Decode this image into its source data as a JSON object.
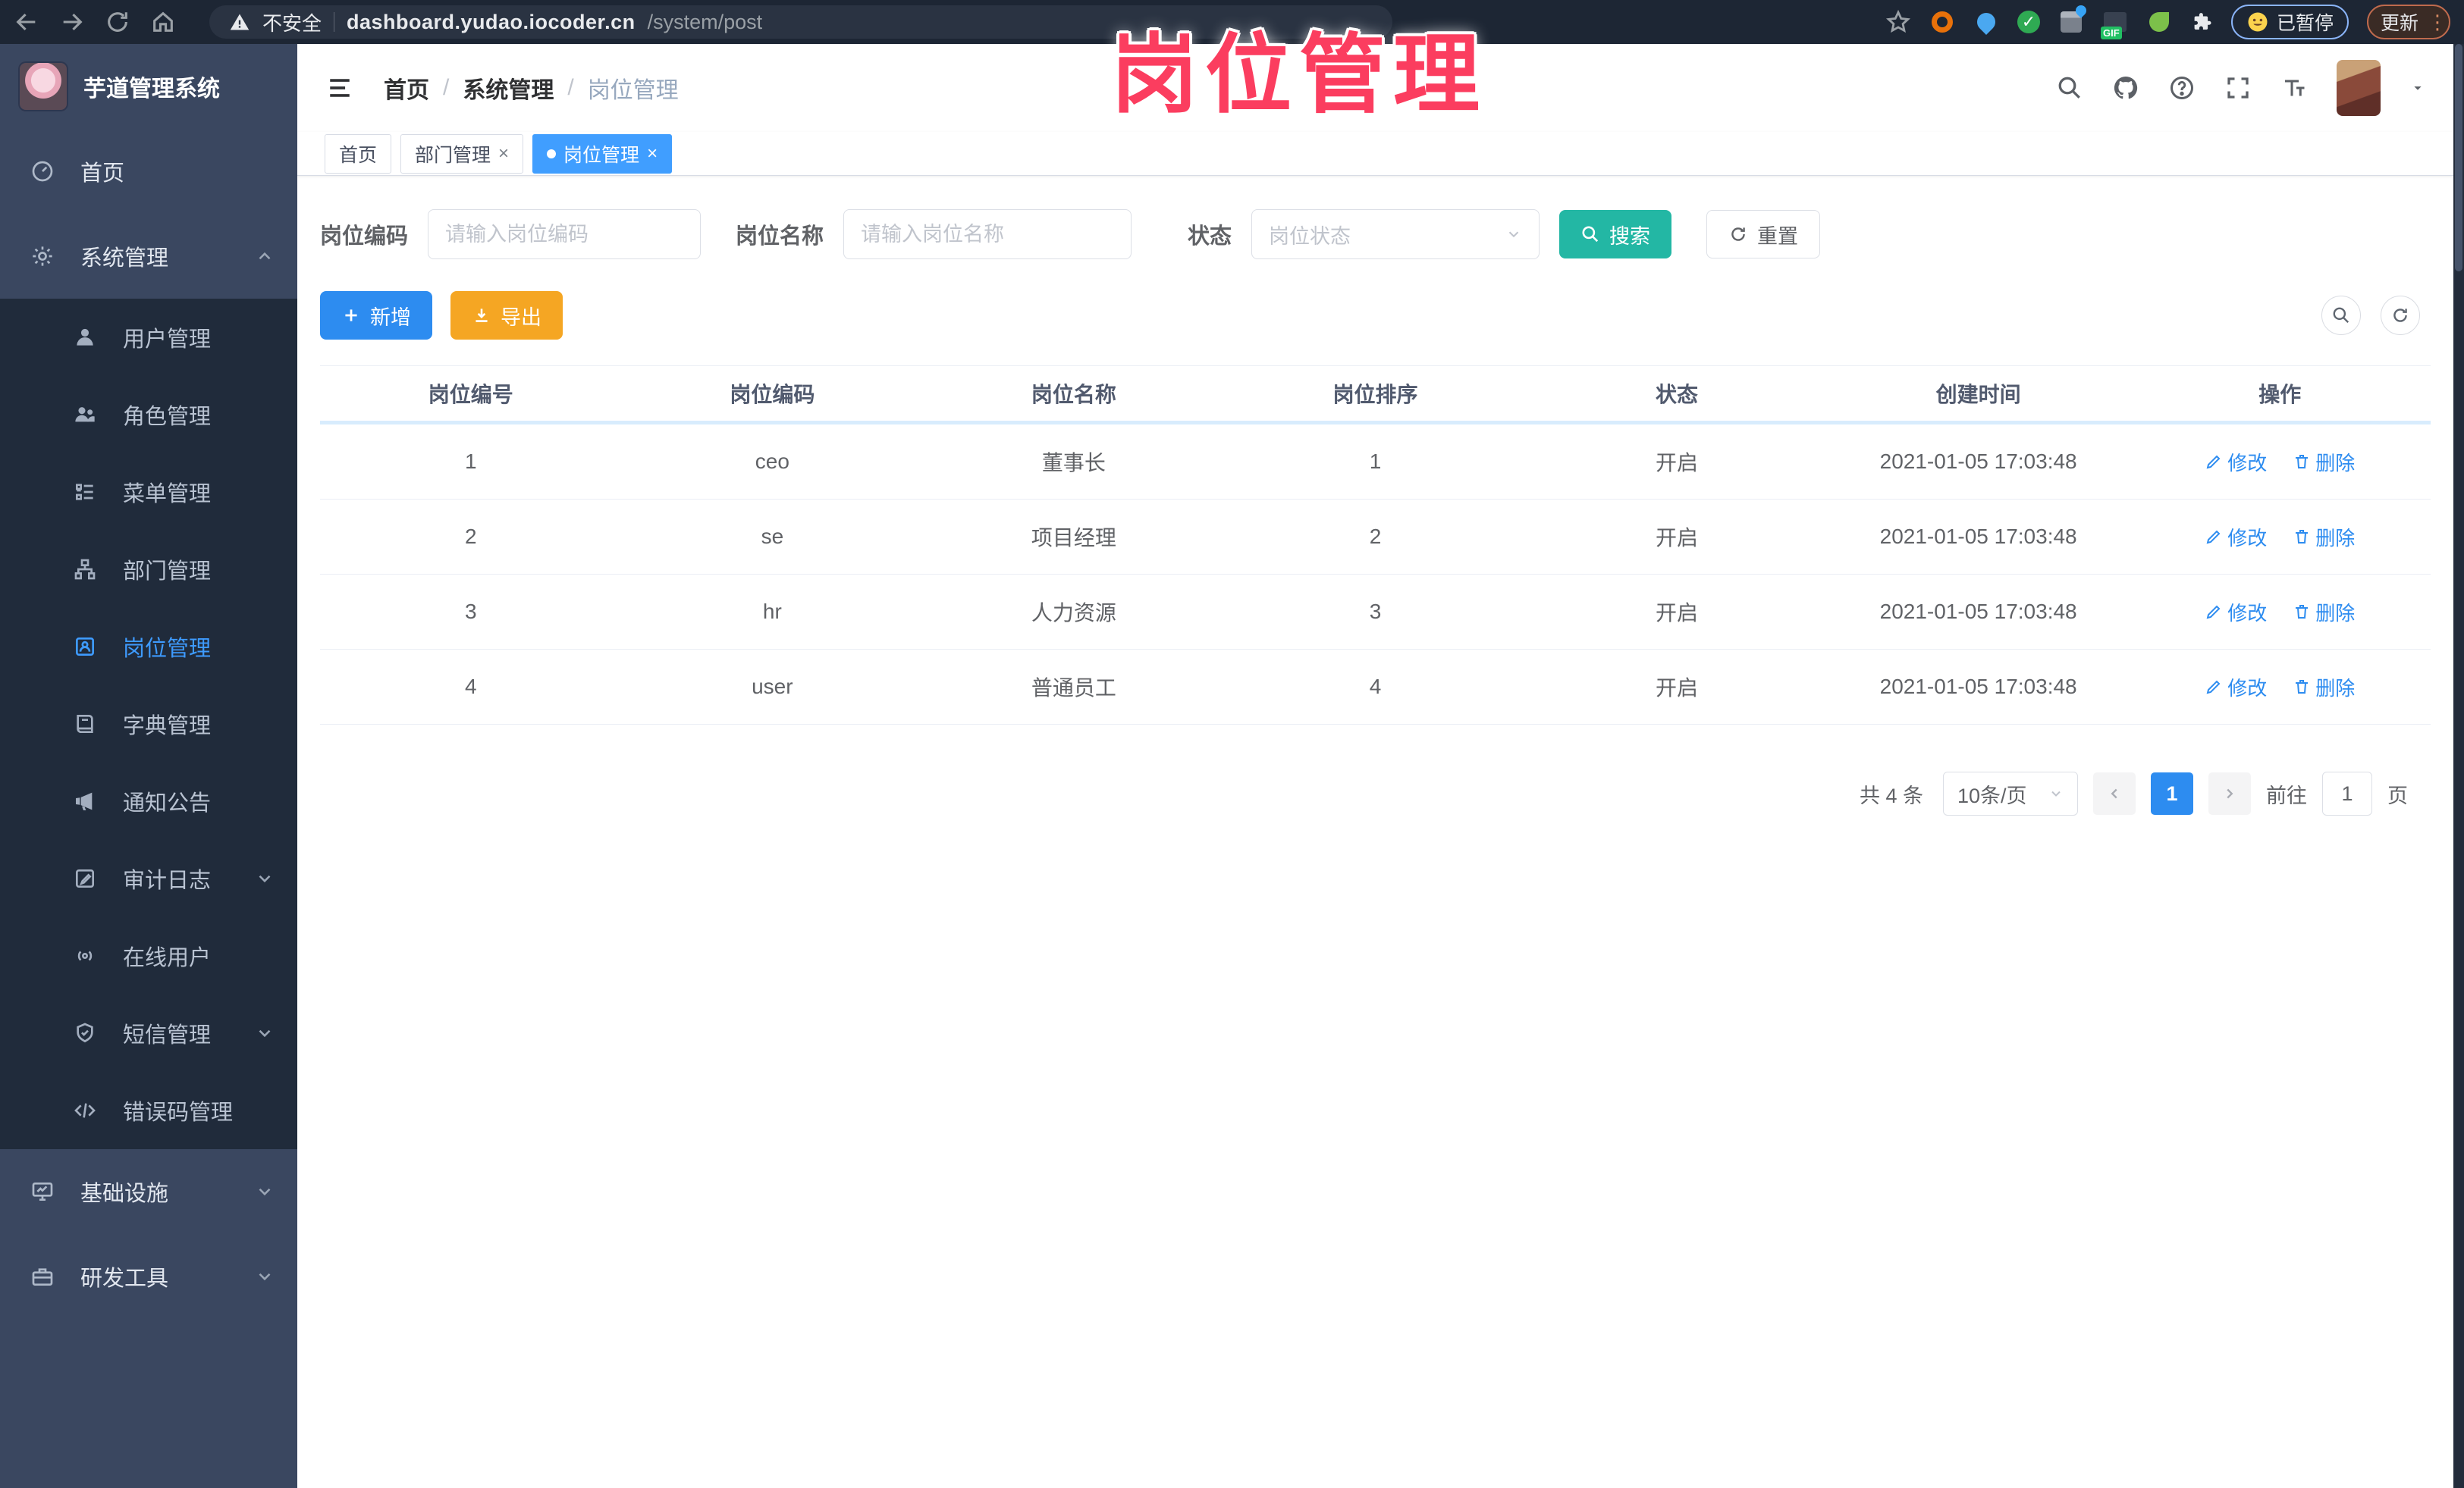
{
  "browser": {
    "security_label": "不安全",
    "url_host": "dashboard.yudao.iocoder.cn",
    "url_path": "/system/post",
    "paused_label": "已暂停",
    "update_label": "更新"
  },
  "overlay": {
    "title": "岗位管理"
  },
  "colors": {
    "accent_blue": "#409eff",
    "primary_button_blue": "#2d8cf0",
    "search_teal": "#23b7a4",
    "export_orange": "#f5a623",
    "overlay_pink": "#fb3d5f",
    "sidebar_bg": "#3a4760",
    "submenu_bg": "#202b3b"
  },
  "sidebar": {
    "logo_title": "芋道管理系统",
    "items": [
      {
        "label": "首页",
        "icon": "home-icon"
      },
      {
        "label": "系统管理",
        "icon": "gear-icon",
        "state": "expanded"
      },
      {
        "label": "用户管理",
        "icon": "user-icon"
      },
      {
        "label": "角色管理",
        "icon": "roles-icon"
      },
      {
        "label": "菜单管理",
        "icon": "menu-list-icon"
      },
      {
        "label": "部门管理",
        "icon": "org-tree-icon"
      },
      {
        "label": "岗位管理",
        "icon": "post-icon",
        "state": "active"
      },
      {
        "label": "字典管理",
        "icon": "dictionary-icon"
      },
      {
        "label": "通知公告",
        "icon": "announcement-icon"
      },
      {
        "label": "审计日志",
        "icon": "audit-log-icon",
        "state": "collapsed"
      },
      {
        "label": "在线用户",
        "icon": "online-users-icon"
      },
      {
        "label": "短信管理",
        "icon": "sms-icon",
        "state": "collapsed"
      },
      {
        "label": "错误码管理",
        "icon": "error-code-icon"
      },
      {
        "label": "基础设施",
        "icon": "infrastructure-icon",
        "state": "collapsed"
      },
      {
        "label": "研发工具",
        "icon": "dev-tools-icon",
        "state": "collapsed"
      }
    ]
  },
  "header": {
    "breadcrumb": [
      "首页",
      "系统管理",
      "岗位管理"
    ]
  },
  "tabs": [
    {
      "label": "首页"
    },
    {
      "label": "部门管理"
    },
    {
      "label": "岗位管理"
    }
  ],
  "filters": {
    "post_code_label": "岗位编码",
    "post_code_placeholder": "请输入岗位编码",
    "post_name_label": "岗位名称",
    "post_name_placeholder": "请输入岗位名称",
    "status_label": "状态",
    "status_placeholder": "岗位状态",
    "search_label": "搜索",
    "reset_label": "重置"
  },
  "toolbar": {
    "add_label": "新增",
    "export_label": "导出"
  },
  "table": {
    "columns": [
      "岗位编号",
      "岗位编码",
      "岗位名称",
      "岗位排序",
      "状态",
      "创建时间",
      "操作"
    ],
    "edit_label": "修改",
    "delete_label": "删除",
    "rows": [
      {
        "id": "1",
        "code": "ceo",
        "name": "董事长",
        "sort": "1",
        "status": "开启",
        "created": "2021-01-05 17:03:48"
      },
      {
        "id": "2",
        "code": "se",
        "name": "项目经理",
        "sort": "2",
        "status": "开启",
        "created": "2021-01-05 17:03:48"
      },
      {
        "id": "3",
        "code": "hr",
        "name": "人力资源",
        "sort": "3",
        "status": "开启",
        "created": "2021-01-05 17:03:48"
      },
      {
        "id": "4",
        "code": "user",
        "name": "普通员工",
        "sort": "4",
        "status": "开启",
        "created": "2021-01-05 17:03:48"
      }
    ]
  },
  "pagination": {
    "total_text": "共 4 条",
    "page_size_value": "10条/页",
    "current_page": "1",
    "goto_label": "前往",
    "goto_value": "1",
    "page_unit": "页"
  }
}
